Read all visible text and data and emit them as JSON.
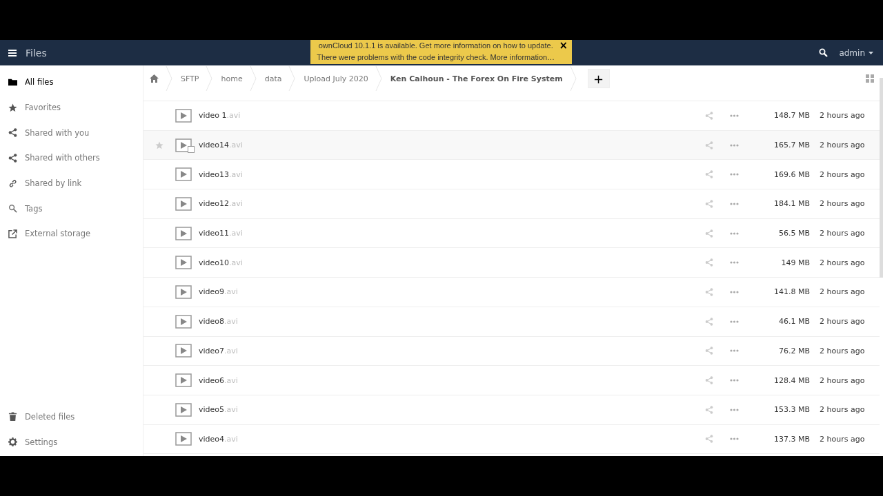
{
  "header": {
    "app_title": "Files",
    "user": "admin"
  },
  "notification": {
    "lines": [
      "ownCloud 10.1.1 is available. Get more information on how to update.",
      "There were problems with the code integrity check. More information…"
    ],
    "close": "×"
  },
  "sidebar": {
    "items": [
      {
        "label": "All files",
        "selected": true
      },
      {
        "label": "Favorites",
        "selected": false
      },
      {
        "label": "Shared with you",
        "selected": false
      },
      {
        "label": "Shared with others",
        "selected": false
      },
      {
        "label": "Shared by link",
        "selected": false
      },
      {
        "label": "Tags",
        "selected": false
      },
      {
        "label": "External storage",
        "selected": false
      }
    ],
    "bottom": [
      {
        "label": "Deleted files"
      },
      {
        "label": "Settings"
      }
    ]
  },
  "breadcrumbs": [
    "SFTP",
    "home",
    "data",
    "Upload July 2020",
    "Ken Calhoun - The Forex On Fire System"
  ],
  "new_button": "+",
  "files": [
    {
      "name": "video 1",
      "ext": ".avi",
      "size": "148.7 MB",
      "modified": "2 hours ago",
      "hovered": false
    },
    {
      "name": "video14",
      "ext": ".avi",
      "size": "165.7 MB",
      "modified": "2 hours ago",
      "hovered": true
    },
    {
      "name": "video13",
      "ext": ".avi",
      "size": "169.6 MB",
      "modified": "2 hours ago",
      "hovered": false
    },
    {
      "name": "video12",
      "ext": ".avi",
      "size": "184.1 MB",
      "modified": "2 hours ago",
      "hovered": false
    },
    {
      "name": "video11",
      "ext": ".avi",
      "size": "56.5 MB",
      "modified": "2 hours ago",
      "hovered": false
    },
    {
      "name": "video10",
      "ext": ".avi",
      "size": "149 MB",
      "modified": "2 hours ago",
      "hovered": false
    },
    {
      "name": "video9",
      "ext": ".avi",
      "size": "141.8 MB",
      "modified": "2 hours ago",
      "hovered": false
    },
    {
      "name": "video8",
      "ext": ".avi",
      "size": "46.1 MB",
      "modified": "2 hours ago",
      "hovered": false
    },
    {
      "name": "video7",
      "ext": ".avi",
      "size": "76.2 MB",
      "modified": "2 hours ago",
      "hovered": false
    },
    {
      "name": "video6",
      "ext": ".avi",
      "size": "128.4 MB",
      "modified": "2 hours ago",
      "hovered": false
    },
    {
      "name": "video5",
      "ext": ".avi",
      "size": "153.3 MB",
      "modified": "2 hours ago",
      "hovered": false
    },
    {
      "name": "video4",
      "ext": ".avi",
      "size": "137.3 MB",
      "modified": "2 hours ago",
      "hovered": false
    }
  ]
}
